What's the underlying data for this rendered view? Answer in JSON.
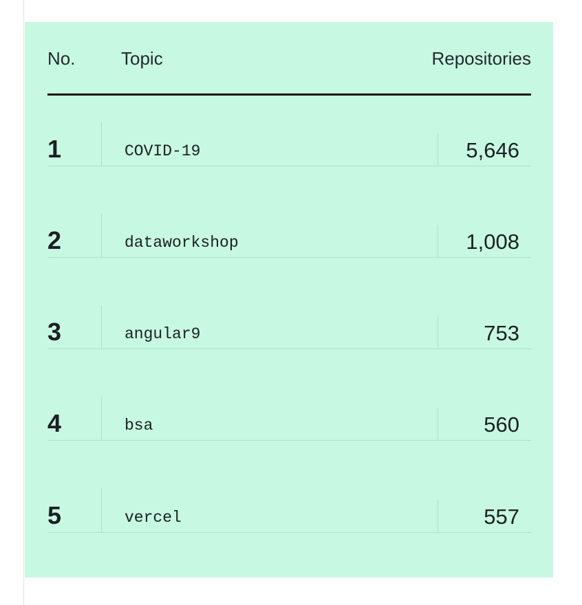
{
  "table": {
    "headers": {
      "no": "No.",
      "topic": "Topic",
      "repositories": "Repositories"
    },
    "rows": [
      {
        "rank": "1",
        "topic": "COVID-19",
        "count": "5,646"
      },
      {
        "rank": "2",
        "topic": "dataworkshop",
        "count": "1,008"
      },
      {
        "rank": "3",
        "topic": "angular9",
        "count": "753"
      },
      {
        "rank": "4",
        "topic": "bsa",
        "count": "560"
      },
      {
        "rank": "5",
        "topic": "vercel",
        "count": "557"
      }
    ]
  },
  "colors": {
    "panel_background": "#c7f8e2",
    "row_divider": "#a8e2cc",
    "header_rule": "#111111"
  }
}
